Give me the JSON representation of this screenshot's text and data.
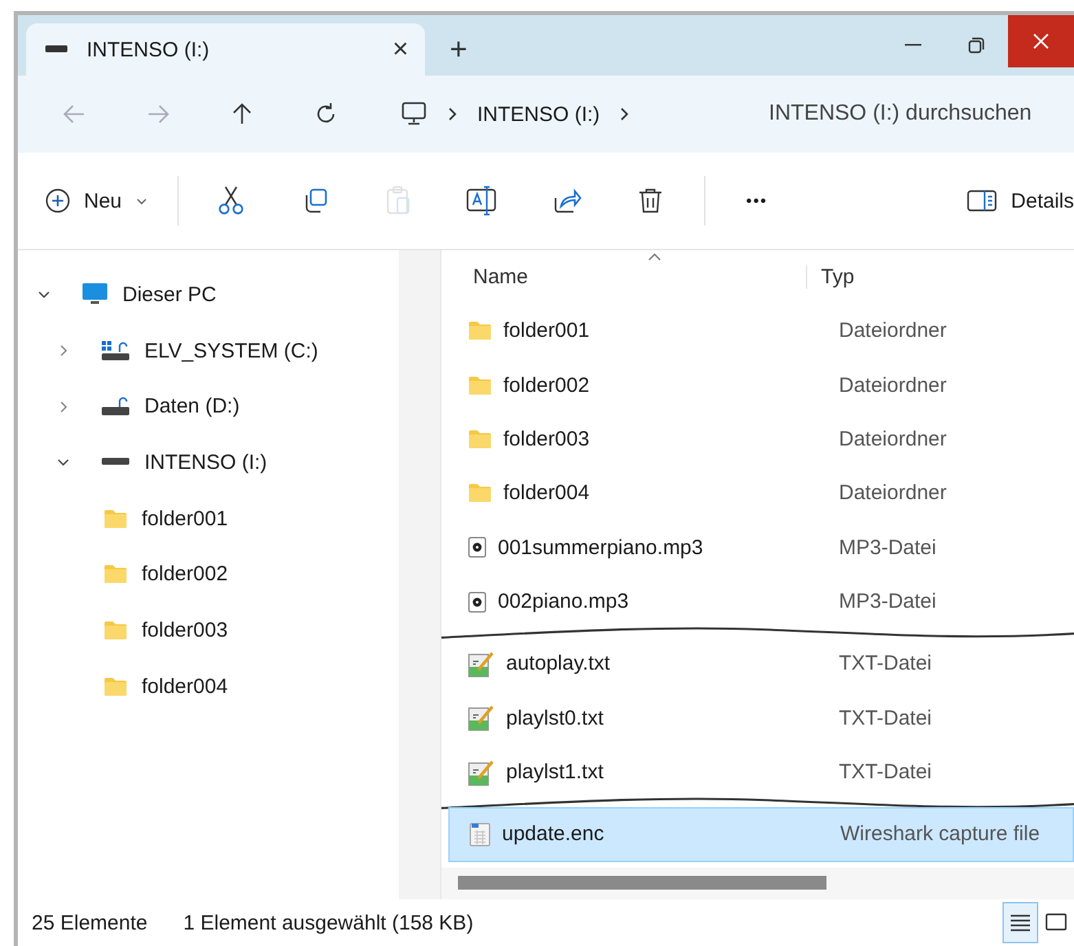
{
  "tabs": [
    {
      "label": "INTENSO (I:)",
      "selected": true,
      "close": "×"
    }
  ],
  "new_tab": "+",
  "address": {
    "crumbs": [
      "INTENSO (I:)"
    ],
    "placeholder": "INTENSO (I:) durchsuchen"
  },
  "nav": [
    {
      "kind": "back",
      "disabled": true
    },
    {
      "kind": "forward",
      "disabled": true
    },
    {
      "kind": "up",
      "disabled": false
    },
    {
      "kind": "refresh",
      "disabled": false
    }
  ],
  "toolbar": {
    "new_label": "Neu",
    "tools": [
      {
        "kind": "cut",
        "disabled": false
      },
      {
        "kind": "copy",
        "disabled": false
      },
      {
        "kind": "paste",
        "disabled": true
      },
      {
        "kind": "rename",
        "disabled": false
      },
      {
        "kind": "share",
        "disabled": false
      },
      {
        "kind": "delete",
        "disabled": false
      }
    ],
    "more": "•••",
    "details": "Details"
  },
  "sidebar": {
    "items": [
      {
        "label": "Dieser PC",
        "kind": "computer",
        "expanded": true,
        "children": [
          {
            "label": "ELV_SYSTEM (C:)",
            "kind": "system-drive",
            "expanded": false
          },
          {
            "label": "Daten (D:)",
            "kind": "drive",
            "expanded": false
          },
          {
            "label": "INTENSO (I:)",
            "kind": "removable-drive",
            "expanded": true,
            "children": [
              {
                "label": "folder001",
                "kind": "folder"
              },
              {
                "label": "folder002",
                "kind": "folder"
              },
              {
                "label": "folder003",
                "kind": "folder"
              },
              {
                "label": "folder004",
                "kind": "folder"
              }
            ]
          }
        ]
      }
    ]
  },
  "table": {
    "columns": [
      "Name",
      "Typ"
    ],
    "rows": [
      {
        "name": "folder001",
        "type": "Dateiordner",
        "kind": "folder",
        "selected": false
      },
      {
        "name": "folder002",
        "type": "Dateiordner",
        "kind": "folder",
        "selected": false
      },
      {
        "name": "folder003",
        "type": "Dateiordner",
        "kind": "folder",
        "selected": false
      },
      {
        "name": "folder004",
        "type": "Dateiordner",
        "kind": "folder",
        "selected": false
      },
      {
        "name": "001summerpiano.mp3",
        "type": "MP3-Datei",
        "kind": "audio",
        "selected": false
      },
      {
        "name": "002piano.mp3",
        "type": "MP3-Datei",
        "kind": "audio",
        "selected": false
      },
      {
        "kind": "break"
      },
      {
        "name": "autoplay.txt",
        "type": "TXT-Datei",
        "kind": "text",
        "selected": false
      },
      {
        "name": "playlst0.txt",
        "type": "TXT-Datei",
        "kind": "text",
        "selected": false
      },
      {
        "name": "playlst1.txt",
        "type": "TXT-Datei",
        "kind": "text",
        "selected": false
      },
      {
        "kind": "break"
      },
      {
        "name": "update.enc",
        "type": "Wireshark capture file",
        "kind": "data",
        "selected": true
      }
    ]
  },
  "status_bar": {
    "count": "25 Elemente",
    "selection": "1 Element ausgewählt (158 KB)",
    "views": [
      {
        "kind": "details",
        "selected": true
      },
      {
        "kind": "tiles",
        "selected": false
      }
    ]
  }
}
